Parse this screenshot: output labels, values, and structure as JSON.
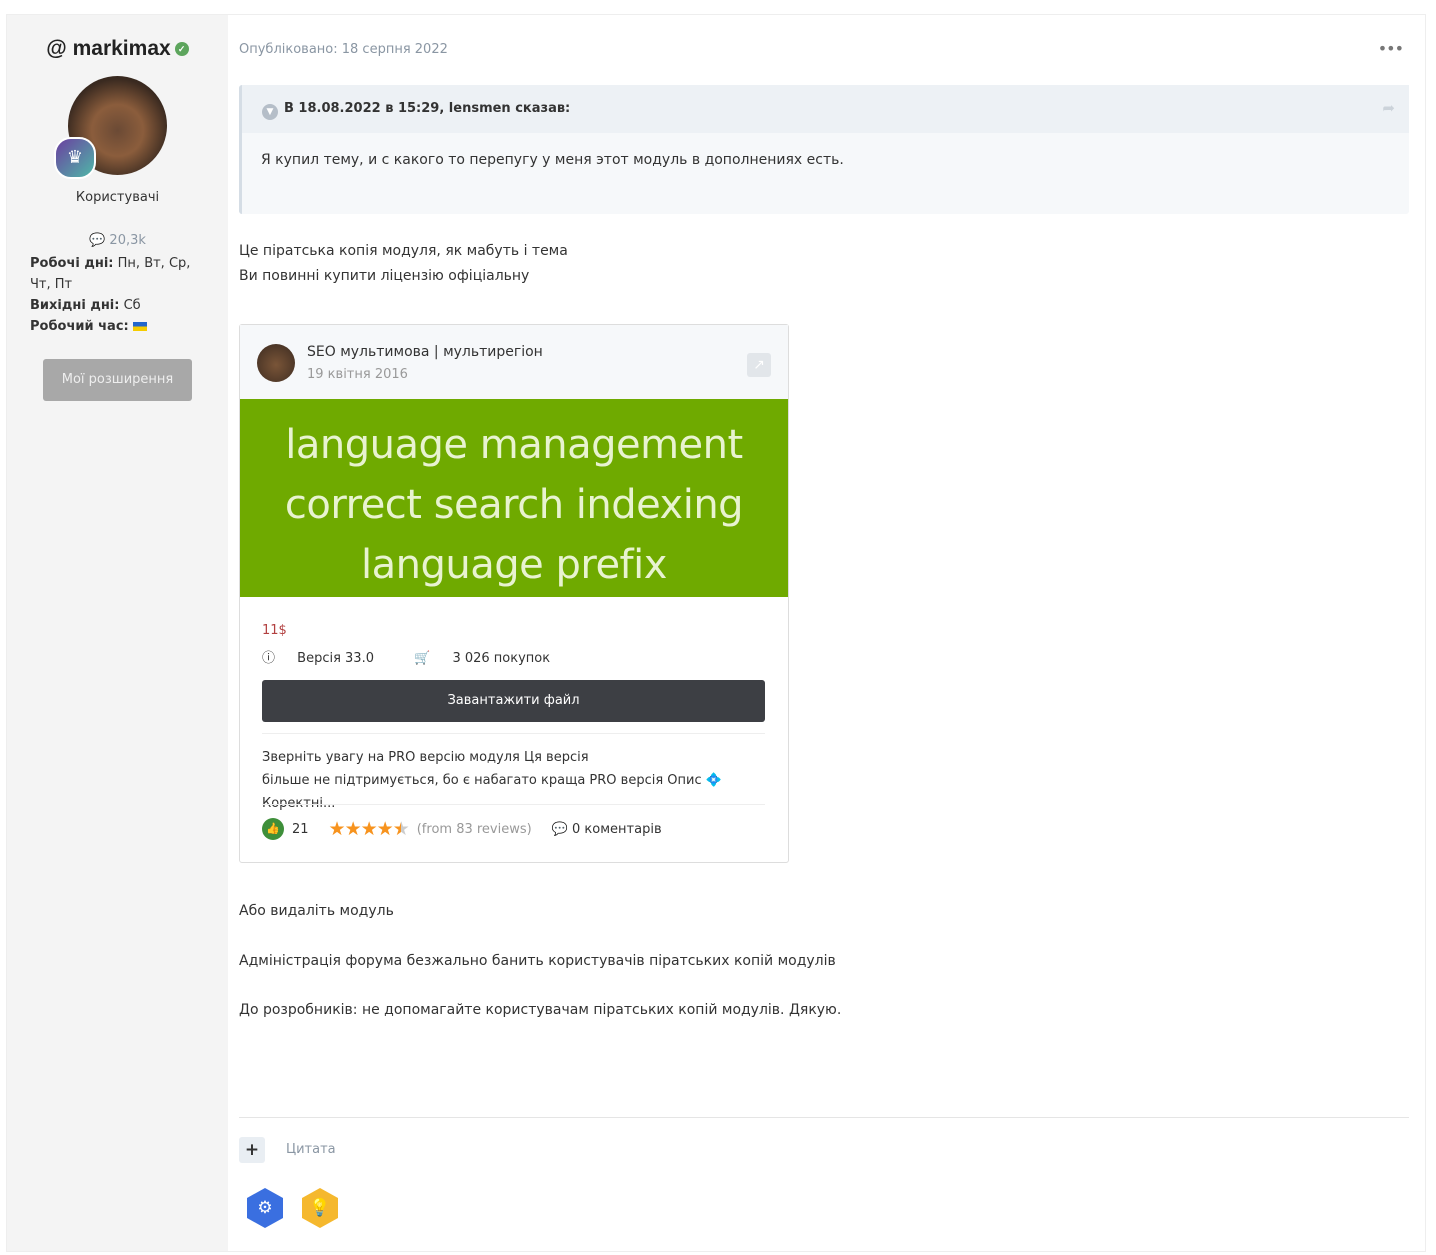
{
  "author": {
    "name": "@ markimax",
    "group": "Користувачі",
    "posts": "20,3k",
    "rows": [
      {
        "label": "Робочі дні:",
        "value": " Пн, Вт, Ср, Чт, Пт"
      },
      {
        "label": "Вихідні дні:",
        "value": " Сб"
      },
      {
        "label": "Робочий час:",
        "value": ""
      }
    ],
    "button": "Мої розширення"
  },
  "post": {
    "date": "Опубліковано: 18 серпня 2022",
    "more": "•••",
    "quote": {
      "header": "В 18.08.2022 в 15:29, lensmen сказав:",
      "body": "Я купил тему, и с какого то перепугу у меня этот модуль в дополнениях есть."
    },
    "p1": "Це піратська копія модуля, як мабуть і тема",
    "p2": "Ви повинні купити ліцензію офіціальну",
    "p3": "Або видаліть модуль",
    "p4": "Адміністрація форума безжально  банить користувачів піратських копій модулів",
    "p5": "До розробників: не допомагайте користувачам піратських копій модулів. Дякую.",
    "cite": "Цитата"
  },
  "card": {
    "title": "SEO мультимова | мультирегіон",
    "date": "19 квітня 2016",
    "banner": [
      "language management",
      "correct search indexing",
      "language prefix"
    ],
    "price": "11$",
    "version": "Версія 33.0",
    "purchases": "3 026 покупок",
    "download": "Завантажити файл",
    "desc1": "Зверніть увагу на PRO версію модуля   Ця версія",
    "desc2": "більше не підтримується, бо є набагато краща PRO версія   Опис 💠 Коректні...",
    "likes": "21",
    "rating": 4.5,
    "reviews": "(from 83 reviews)",
    "comments": "0 коментарів"
  }
}
